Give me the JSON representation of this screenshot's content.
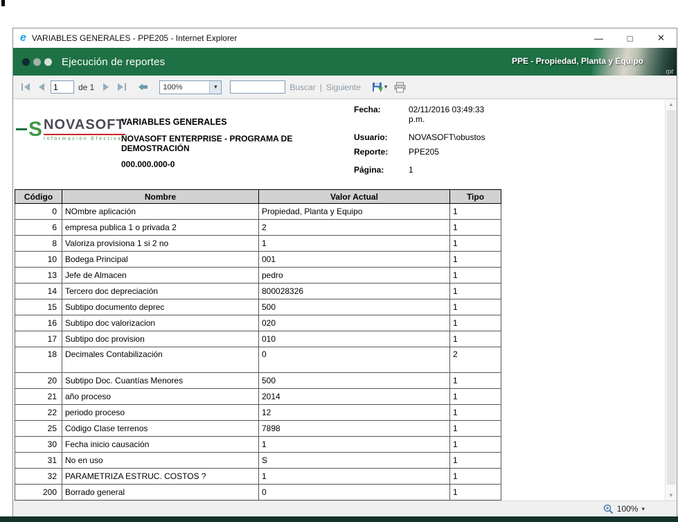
{
  "window": {
    "title": "VARIABLES GENERALES - PPE205 - Internet Explorer",
    "controls": {
      "minimize": "—",
      "maximize": "□",
      "close": "✕"
    }
  },
  "banner": {
    "title": "Ejecución de reportes",
    "module": "PPE - Propiedad, Planta y Equipo",
    "watermark": "rpt",
    "colors": {
      "background": "#1E7145"
    }
  },
  "toolbar": {
    "page_input": "1",
    "page_total_label": "de 1",
    "zoom_select": "100%",
    "search_input": "",
    "find_label": "Buscar",
    "separator": "|",
    "next_label": "Siguiente",
    "dropdown_caret": "▾"
  },
  "report": {
    "logo": {
      "name": "NOVASOFT",
      "mark": "S",
      "tagline": "Información Efectiva"
    },
    "title": "VARIABLES GENERALES",
    "subtitle": "NOVASOFT ENTERPRISE - PROGRAMA DE DEMOSTRACIÓN",
    "company_id": "000.000.000-0",
    "meta": [
      {
        "label": "Fecha:",
        "value": "02/11/2016 03:49:33 p.m."
      },
      {
        "label": "Usuario:",
        "value": "NOVASOFT\\obustos"
      },
      {
        "label": "Reporte:",
        "value": "PPE205"
      },
      {
        "label": "Página:",
        "value": "1"
      }
    ]
  },
  "table": {
    "headers": [
      "Código",
      "Nombre",
      "Valor Actual",
      "Tipo"
    ],
    "rows": [
      {
        "codigo": "0",
        "nombre": "NOmbre aplicación",
        "valor": "Propiedad, Planta y Equipo",
        "tipo": "1"
      },
      {
        "codigo": "6",
        "nombre": "empresa publica 1 o privada 2",
        "valor": "2",
        "tipo": "1"
      },
      {
        "codigo": "8",
        "nombre": "Valoriza provisiona 1 si 2 no",
        "valor": "1",
        "tipo": "1"
      },
      {
        "codigo": "10",
        "nombre": "Bodega Principal",
        "valor": "001",
        "tipo": "1"
      },
      {
        "codigo": "13",
        "nombre": "Jefe de Almacen",
        "valor": "pedro",
        "tipo": "1"
      },
      {
        "codigo": "14",
        "nombre": "Tercero doc depreciación",
        "valor": "800028326",
        "tipo": "1"
      },
      {
        "codigo": "15",
        "nombre": "Subtipo documento deprec",
        "valor": "500",
        "tipo": "1"
      },
      {
        "codigo": "16",
        "nombre": "Subtipo doc valorizacion",
        "valor": "020",
        "tipo": "1"
      },
      {
        "codigo": "17",
        "nombre": "Subtipo doc provision",
        "valor": "010",
        "tipo": "1"
      },
      {
        "codigo": "18",
        "nombre": "Decimales Contabilización",
        "valor": "0",
        "tipo": "2",
        "tall": true
      },
      {
        "codigo": "20",
        "nombre": "Subtipo Doc. Cuantías Menores",
        "valor": "500",
        "tipo": "1"
      },
      {
        "codigo": "21",
        "nombre": "año proceso",
        "valor": "2014",
        "tipo": "1"
      },
      {
        "codigo": "22",
        "nombre": "periodo proceso",
        "valor": "12",
        "tipo": "1"
      },
      {
        "codigo": "25",
        "nombre": "Código Clase terrenos",
        "valor": "7898",
        "tipo": "1"
      },
      {
        "codigo": "30",
        "nombre": "Fecha inicio causación",
        "valor": "1",
        "tipo": "1"
      },
      {
        "codigo": "31",
        "nombre": "No en uso",
        "valor": "S",
        "tipo": "1"
      },
      {
        "codigo": "32",
        "nombre": "PARAMETRIZA ESTRUC. COSTOS ?",
        "valor": "1",
        "tipo": "1"
      },
      {
        "codigo": "200",
        "nombre": "Borrado general",
        "valor": "0",
        "tipo": "1"
      }
    ]
  },
  "statusbar": {
    "zoom": "100%",
    "caret": "▾"
  }
}
